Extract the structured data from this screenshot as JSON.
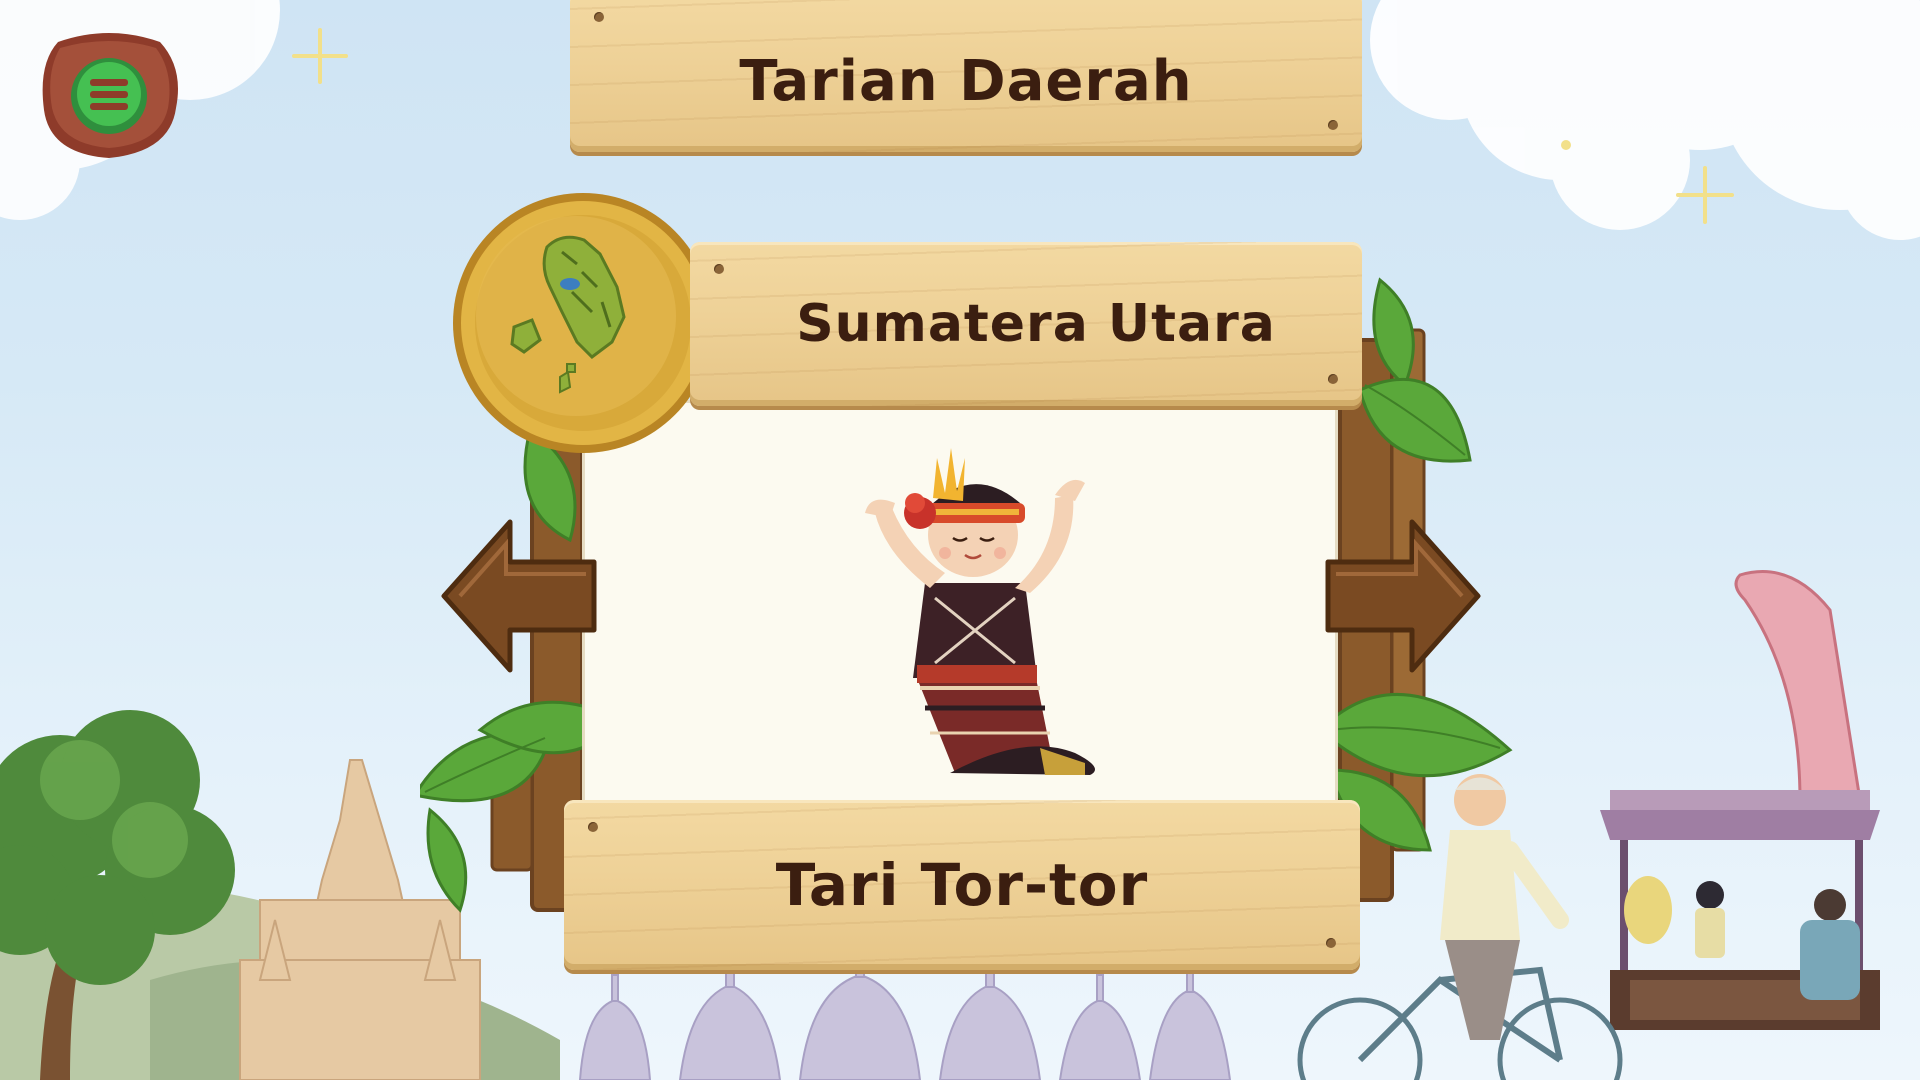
{
  "header": {
    "title": "Tarian Daerah"
  },
  "province": {
    "name": "Sumatera Utara"
  },
  "dance": {
    "name": "Tari Tor-tor"
  },
  "icons": {
    "menu": "menu-icon",
    "map_badge": "map-icon",
    "prev": "arrow-left-icon",
    "next": "arrow-right-icon"
  },
  "colors": {
    "text": "#3b1e10",
    "wood_plank": "#eed197",
    "wood_frame": "#8b5a2b",
    "leaf": "#5aa83a",
    "gold": "#d8a93a",
    "menu_green": "#3cb44a",
    "menu_wood": "#8e3b2a"
  }
}
